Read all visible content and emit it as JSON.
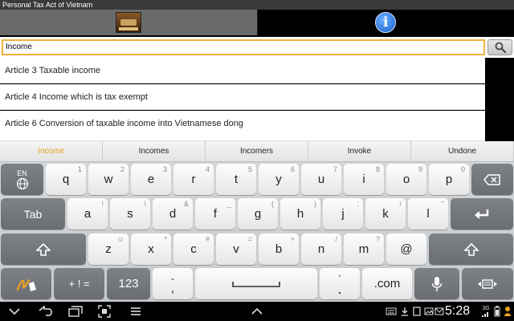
{
  "window": {
    "title": "Personal Tax Act of Vietnam"
  },
  "tabs": [
    {
      "id": "home",
      "icon": "law-book-icon"
    },
    {
      "id": "info",
      "icon": "info-icon",
      "glyph": "i"
    }
  ],
  "search": {
    "value": "Income",
    "button_icon": "search-icon"
  },
  "results": [
    {
      "label": "Article 3 Taxable income"
    },
    {
      "label": "Article 4 Income which is tax exempt"
    },
    {
      "label": "Article 6 Conversion of taxable income into Vietnamese dong"
    }
  ],
  "keyboard": {
    "suggestions": [
      "Income",
      "Incomes",
      "Incomers",
      "Invoke",
      "Undone"
    ],
    "row1": [
      {
        "main": "q",
        "sub": "1"
      },
      {
        "main": "w",
        "sub": "2"
      },
      {
        "main": "e",
        "sub": "3"
      },
      {
        "main": "r",
        "sub": "4"
      },
      {
        "main": "t",
        "sub": "5"
      },
      {
        "main": "y",
        "sub": "6"
      },
      {
        "main": "u",
        "sub": "7"
      },
      {
        "main": "i",
        "sub": "8"
      },
      {
        "main": "o",
        "sub": "9"
      },
      {
        "main": "p",
        "sub": "0"
      }
    ],
    "row2": [
      {
        "main": "a",
        "sub": "!"
      },
      {
        "main": "s",
        "sub": "\\"
      },
      {
        "main": "d",
        "sub": "&"
      },
      {
        "main": "f",
        "sub": "_"
      },
      {
        "main": "g",
        "sub": "("
      },
      {
        "main": "h",
        "sub": ")"
      },
      {
        "main": "j",
        "sub": ":"
      },
      {
        "main": "k",
        "sub": "/"
      },
      {
        "main": "l",
        "sub": "\""
      }
    ],
    "row3": [
      {
        "main": "z",
        "sub": "☺"
      },
      {
        "main": "x",
        "sub": "*"
      },
      {
        "main": "c",
        "sub": "#"
      },
      {
        "main": "v",
        "sub": "="
      },
      {
        "main": "b",
        "sub": "+"
      },
      {
        "main": "n",
        "sub": "/"
      },
      {
        "main": "m",
        "sub": "?"
      },
      {
        "main": "@",
        "sub": ""
      }
    ],
    "lang_label": "EN",
    "tab_label": "Tab",
    "symbols_label": "+ ! =",
    "numbers_label": "123",
    "comma_sub": "-",
    "comma_main": ",",
    "period_sub": "'",
    "period_main": ".",
    "dotcom_label": ".com"
  },
  "status": {
    "clock": "5:28",
    "network": "3G"
  }
}
